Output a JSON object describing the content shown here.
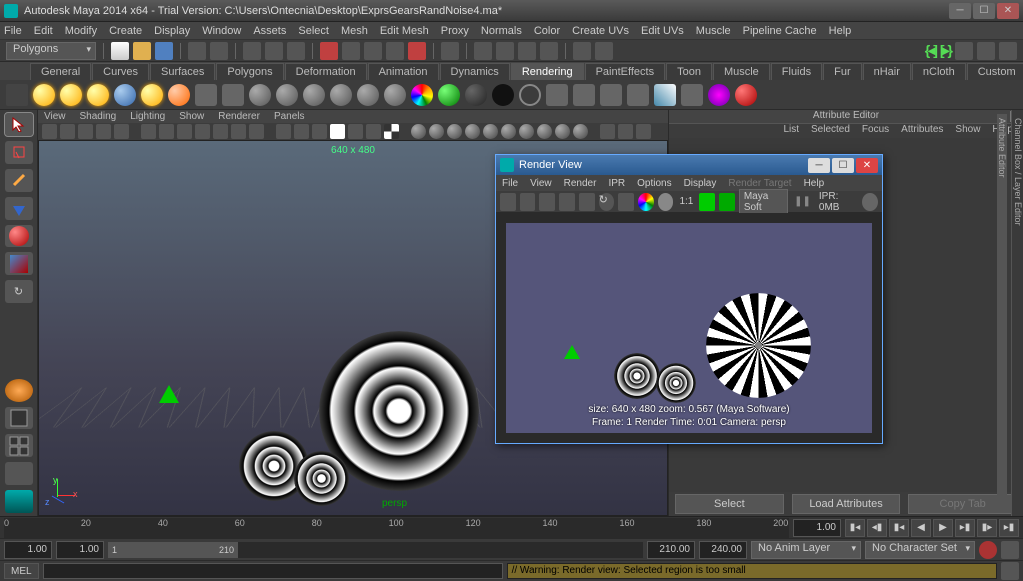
{
  "title": "Autodesk Maya 2014 x64 - Trial Version: C:\\Users\\Ontecnia\\Desktop\\ExprsGearsRandNoise4.ma*",
  "main_menu": [
    "File",
    "Edit",
    "Modify",
    "Create",
    "Display",
    "Window",
    "Assets",
    "Select",
    "Mesh",
    "Edit Mesh",
    "Proxy",
    "Normals",
    "Color",
    "Create UVs",
    "Edit UVs",
    "Muscle",
    "Pipeline Cache",
    "Help"
  ],
  "mode_selector": "Polygons",
  "shelf_tabs": [
    "General",
    "Curves",
    "Surfaces",
    "Polygons",
    "Deformation",
    "Animation",
    "Dynamics",
    "Rendering",
    "PaintEffects",
    "Toon",
    "Muscle",
    "Fluids",
    "Fur",
    "nHair",
    "nCloth",
    "Custom"
  ],
  "shelf_active": "Rendering",
  "viewport_menu": [
    "View",
    "Shading",
    "Lighting",
    "Show",
    "Renderer",
    "Panels"
  ],
  "resolution_gate": "640 x 480",
  "camera_label": "persp",
  "attr_editor": {
    "title": "Attribute Editor",
    "links": [
      "List",
      "Selected",
      "Focus",
      "Attributes",
      "Show",
      "Help"
    ],
    "buttons": {
      "select": "Select",
      "load": "Load Attributes",
      "copy": "Copy Tab"
    }
  },
  "right_tabs": [
    "Channel Box / Layer Editor",
    "Attribute Editor"
  ],
  "render_view": {
    "title": "Render View",
    "menu": [
      "File",
      "View",
      "Render",
      "IPR",
      "Options",
      "Display",
      "Render Target",
      "Help"
    ],
    "renderer_field": "Maya Soft",
    "ipr_info": "IPR: 0MB",
    "ratio": "1:1",
    "info_line1": "size: 640 x 480    zoom: 0.567    (Maya Software)",
    "info_line2": "Frame: 1        Render Time: 0:01        Camera: persp"
  },
  "timeline": {
    "ticks": [
      "0",
      "20",
      "40",
      "60",
      "80",
      "100",
      "120",
      "140",
      "160",
      "180",
      "200"
    ],
    "current_frame": "1.00",
    "range_handle_start": "1",
    "range_handle_end": "210",
    "start_field": "1.00",
    "start_range_field": "1.00",
    "end_range_field": "210.00",
    "end_field": "240.00",
    "anim_layer": "No Anim Layer",
    "char_set": "No Character Set"
  },
  "cmdline": {
    "label": "MEL",
    "feedback": "// Warning: Render view: Selected region is too small"
  }
}
